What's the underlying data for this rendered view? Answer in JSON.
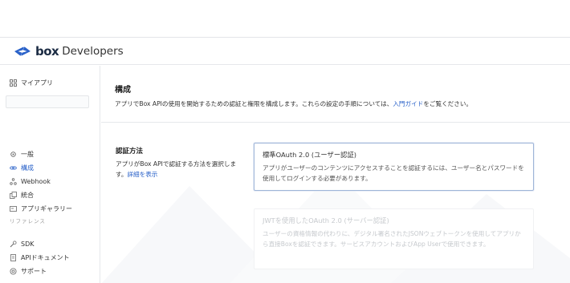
{
  "header": {
    "logo_box": "box",
    "logo_developers": "Developers"
  },
  "sidebar": {
    "my_apps": {
      "label": "マイアプリ",
      "icon": "grid-icon"
    },
    "items": [
      {
        "label": "一般",
        "icon": "gear-icon",
        "active": false
      },
      {
        "label": "構成",
        "icon": "link-icon",
        "active": true
      },
      {
        "label": "Webhook",
        "icon": "webhook-icon",
        "active": false
      },
      {
        "label": "統合",
        "icon": "copy-icon",
        "active": false
      },
      {
        "label": "アプリギャラリー",
        "icon": "card-icon",
        "active": false
      }
    ],
    "reference_label": "リファレンス",
    "reference_items": [
      {
        "label": "SDK",
        "icon": "wrench-icon"
      },
      {
        "label": "APIドキュメント",
        "icon": "document-icon"
      },
      {
        "label": "サポート",
        "icon": "lifebuoy-icon"
      }
    ]
  },
  "main": {
    "title": "構成",
    "desc_prefix": "アプリでBox APIの使用を開始するための認証と権限を構成します。これらの設定の手順については、",
    "desc_link": "入門ガイド",
    "desc_suffix": "をご覧ください。",
    "auth_section": {
      "title": "認証方法",
      "desc": "アプリがBox APIで認証する方法を選択します。",
      "desc_link": "詳細を表示"
    },
    "auth_options": [
      {
        "title": "標準OAuth 2.0 (ユーザー認証)",
        "text": "アプリがユーザーのコンテンツにアクセスすることを認証するには、ユーザー名とパスワードを使用してログインする必要があります。",
        "selected": true
      },
      {
        "title": "JWTを使用したOAuth 2.0 (サーバー認証)",
        "text": "ユーザーの資格情報の代わりに、デジタル署名されたJSONウェブトークンを使用してアプリから直接Boxを認証できます。サービスアカウントおよびApp Userで使用できます。",
        "selected": false
      }
    ]
  },
  "colors": {
    "accent": "#2a62c9",
    "text": "#222222",
    "border": "#e6e8eb"
  }
}
